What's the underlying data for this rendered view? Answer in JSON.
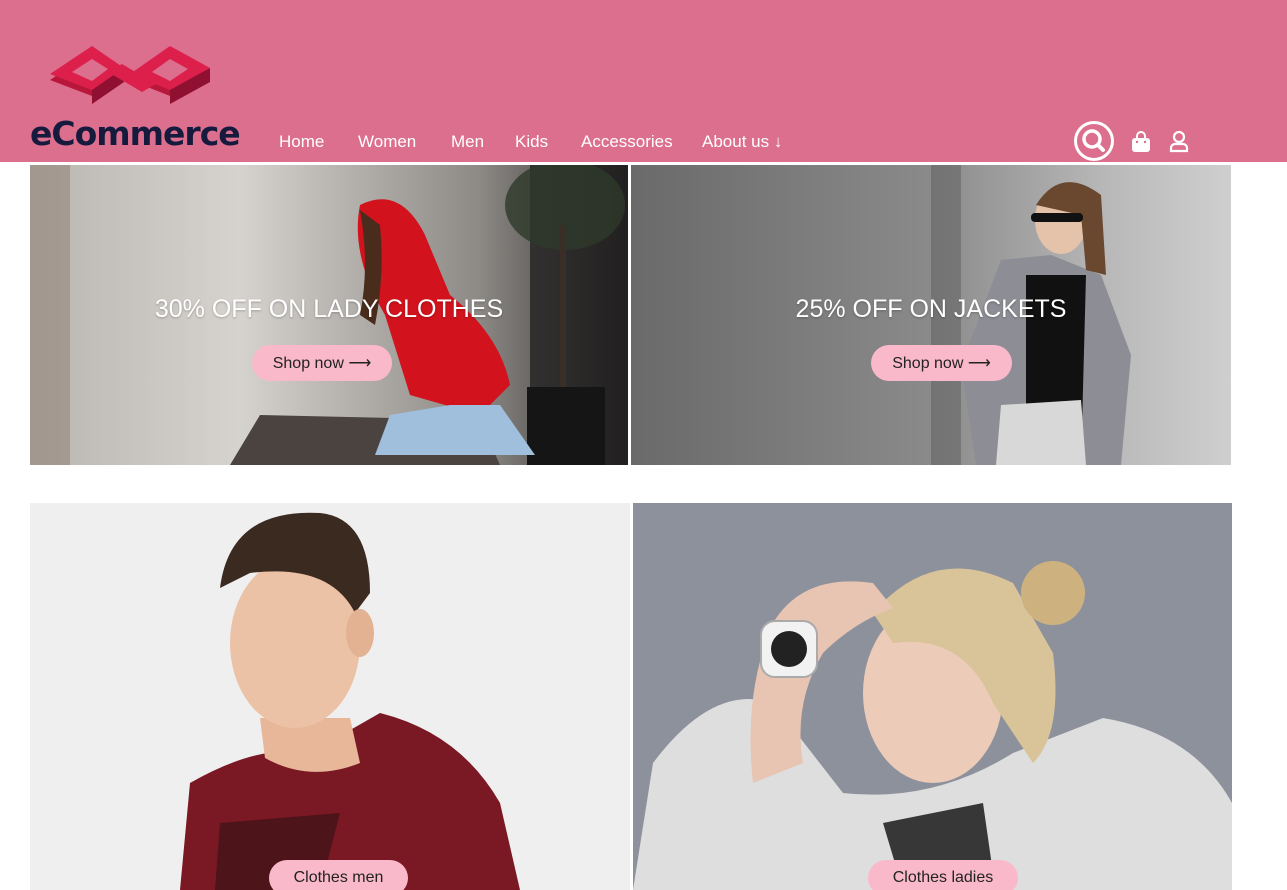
{
  "brand": {
    "name": "eCommerce"
  },
  "nav": {
    "items": [
      "Home",
      "Women",
      "Men",
      "Kids",
      "Accessories",
      "About us ↓"
    ]
  },
  "icons": {
    "search": "search-icon",
    "bag": "shopping-bag-icon",
    "user": "user-icon"
  },
  "banners": [
    {
      "title": "30% OFF ON LADY CLOTHES",
      "cta": "Shop now ⟶"
    },
    {
      "title": "25% OFF ON JACKETS",
      "cta": "Shop now ⟶"
    }
  ],
  "tiles": [
    {
      "label": "Clothes men"
    },
    {
      "label": "Clothes ladies"
    }
  ],
  "colors": {
    "header": "#dc6e8e",
    "logo_mark": "#dd1f4b",
    "logo_text": "#161b3d",
    "pill": "#f9b9cb"
  }
}
